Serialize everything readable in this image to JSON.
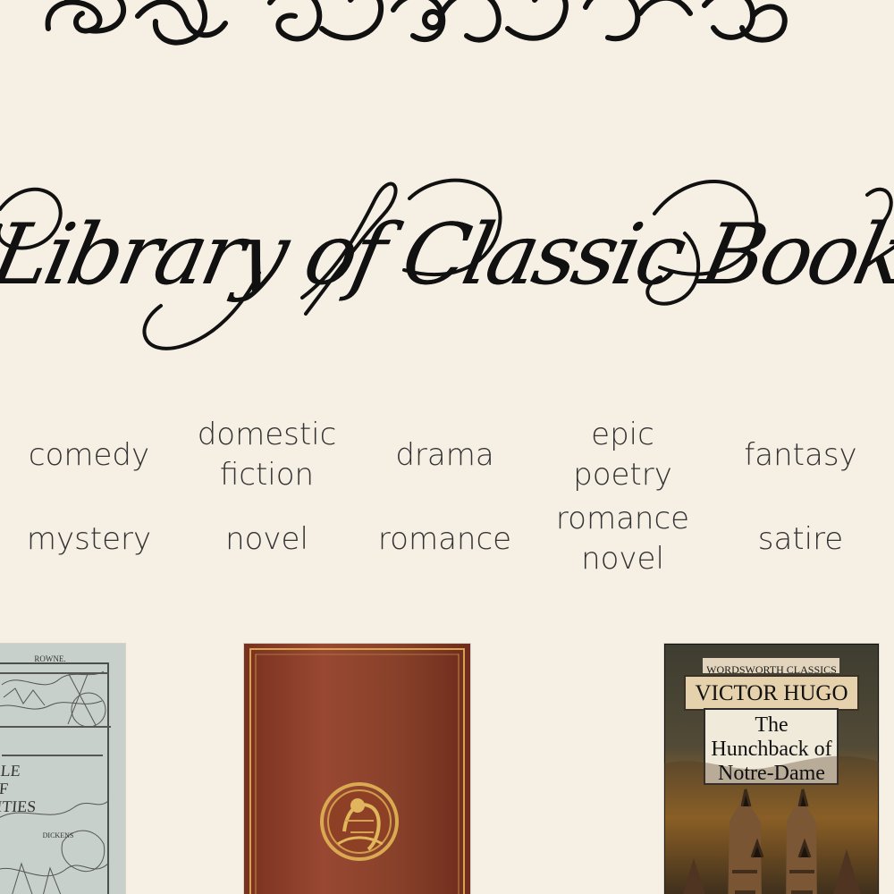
{
  "header": {
    "site_title": "Library of Classic Books"
  },
  "genres": [
    {
      "label_html": "comedy"
    },
    {
      "label_html": "domestic<br>fiction"
    },
    {
      "label_html": "drama"
    },
    {
      "label_html": "epic<br>poetry"
    },
    {
      "label_html": "fantasy"
    },
    {
      "label_html": "mystery"
    },
    {
      "label_html": "novel"
    },
    {
      "label_html": "romance"
    },
    {
      "label_html": "romance<br>novel"
    },
    {
      "label_html": "satire"
    }
  ],
  "books": {
    "tale": {
      "top_text": "ROWNE.",
      "title_fragment": "ALE\nOF\nCITIES",
      "author_fragment": "DICKENS"
    },
    "hugo": {
      "series": "WORDSWORTH CLASSICS",
      "author": "VICTOR HUGO",
      "title": "The\nHunchback of\nNotre-Dame"
    }
  },
  "colors": {
    "background": "#f6efe4",
    "text": "#333333",
    "title": "#111111",
    "alice_cover": "#8a3e28",
    "hugo_label": "#e8d6b5"
  }
}
